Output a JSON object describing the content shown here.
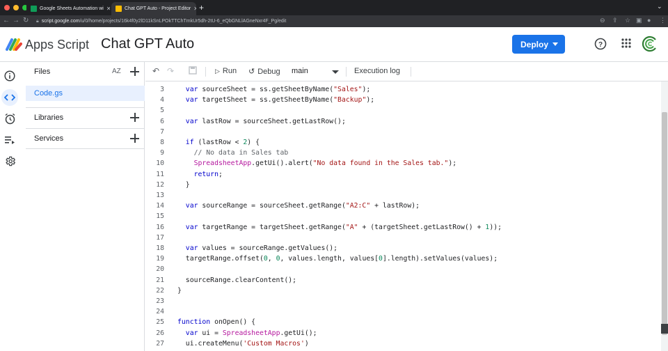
{
  "browser": {
    "tabs": [
      {
        "title": "Google Sheets Automation wi",
        "fav_color": "#0f9d58"
      },
      {
        "title": "Chat GPT Auto - Project Editor",
        "fav_color": "#fbbc04"
      }
    ],
    "url_host": "script.google.com",
    "url_path": "/u/0/home/projects/16k4f0y2lD11kSnLPOkTTChTmkUr5dh-2tU-6_eQbGNLlAGneNxr4F_Pg/edit"
  },
  "header": {
    "brand": "Apps Script",
    "project_name": "Chat GPT Auto",
    "deploy_label": "Deploy"
  },
  "files_panel": {
    "title": "Files",
    "sort_label": "AZ",
    "files": [
      "Code.gs"
    ],
    "libraries_label": "Libraries",
    "services_label": "Services"
  },
  "toolbar": {
    "run_label": "Run",
    "debug_label": "Debug",
    "function_name": "main",
    "execution_log_label": "Execution log"
  },
  "editor": {
    "lines": [
      {
        "n": "3",
        "code": "  var sourceSheet = ss.getSheetByName(\"Sales\");"
      },
      {
        "n": "4",
        "code": "  var targetSheet = ss.getSheetByName(\"Backup\");"
      },
      {
        "n": "5",
        "code": ""
      },
      {
        "n": "6",
        "code": "  var lastRow = sourceSheet.getLastRow();"
      },
      {
        "n": "7",
        "code": ""
      },
      {
        "n": "8",
        "code": "  if (lastRow < 2) {"
      },
      {
        "n": "9",
        "code": "    // No data in Sales tab"
      },
      {
        "n": "10",
        "code": "    SpreadsheetApp.getUi().alert(\"No data found in the Sales tab.\");"
      },
      {
        "n": "11",
        "code": "    return;"
      },
      {
        "n": "12",
        "code": "  }"
      },
      {
        "n": "13",
        "code": ""
      },
      {
        "n": "14",
        "code": "  var sourceRange = sourceSheet.getRange(\"A2:C\" + lastRow);"
      },
      {
        "n": "15",
        "code": ""
      },
      {
        "n": "16",
        "code": "  var targetRange = targetSheet.getRange(\"A\" + (targetSheet.getLastRow() + 1));"
      },
      {
        "n": "17",
        "code": ""
      },
      {
        "n": "18",
        "code": "  var values = sourceRange.getValues();"
      },
      {
        "n": "19",
        "code": "  targetRange.offset(0, 0, values.length, values[0].length).setValues(values);"
      },
      {
        "n": "20",
        "code": ""
      },
      {
        "n": "21",
        "code": "  sourceRange.clearContent();"
      },
      {
        "n": "22",
        "code": "}"
      },
      {
        "n": "23",
        "code": ""
      },
      {
        "n": "24",
        "code": ""
      },
      {
        "n": "25",
        "code": "function onOpen() {"
      },
      {
        "n": "26",
        "code": "  var ui = SpreadsheetApp.getUi();"
      },
      {
        "n": "27",
        "code": "  ui.createMenu('Custom Macros')"
      }
    ]
  }
}
